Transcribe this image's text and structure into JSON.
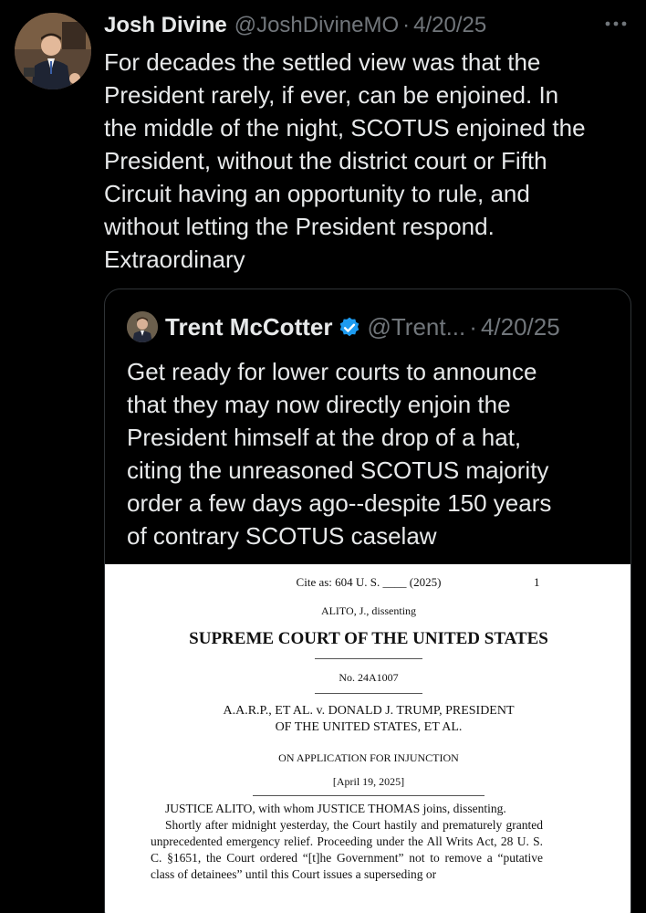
{
  "tweet": {
    "author_name": "Josh Divine",
    "author_handle": "@JoshDivineMO",
    "separator": "·",
    "date": "4/20/25",
    "more_icon": "more-horizontal-icon",
    "text": "For decades the settled view was that the\nPresident rarely, if ever, can be enjoined. In\nthe middle of the night, SCOTUS enjoined the\nPresident, without the district court or Fifth\nCircuit having an opportunity to rule, and\nwithout letting the President respond.\nExtraordinary"
  },
  "quoted_tweet": {
    "author_name": "Trent McCotter",
    "verified_icon": "verified-badge-icon",
    "verified_color": "#1d9bf0",
    "author_handle": "@Trent...",
    "separator": "·",
    "date": "4/20/25",
    "text": "Get ready for lower courts to announce\nthat they may now directly enjoin the\nPresident himself at the drop of a hat,\nciting the unreasoned SCOTUS majority\norder a few days ago--despite 150 years\nof contrary SCOTUS caselaw"
  },
  "document": {
    "cite": "Cite as: 604 U. S. ____ (2025)",
    "page_number": "1",
    "dissent_heading": "ALITO, J., dissenting",
    "court": "SUPREME COURT OF THE UNITED STATES",
    "docket": "No. 24A1007",
    "caption_line1": "A.A.R.P., ET AL. v. DONALD J. TRUMP, PRESIDENT",
    "caption_line2": "OF THE UNITED STATES, ET AL.",
    "application": "ON APPLICATION FOR INJUNCTION",
    "decision_date": "[April 19, 2025]",
    "para1": "JUSTICE ALITO, with whom JUSTICE THOMAS joins, dissenting.",
    "para2": "Shortly after midnight yesterday, the Court hastily and prematurely granted unprecedented emergency relief. Proceeding under the All Writs Act, 28 U. S. C. §1651, the Court ordered “[t]he Government” not to remove a “putative class of detainees” until this Court issues a superseding or"
  }
}
